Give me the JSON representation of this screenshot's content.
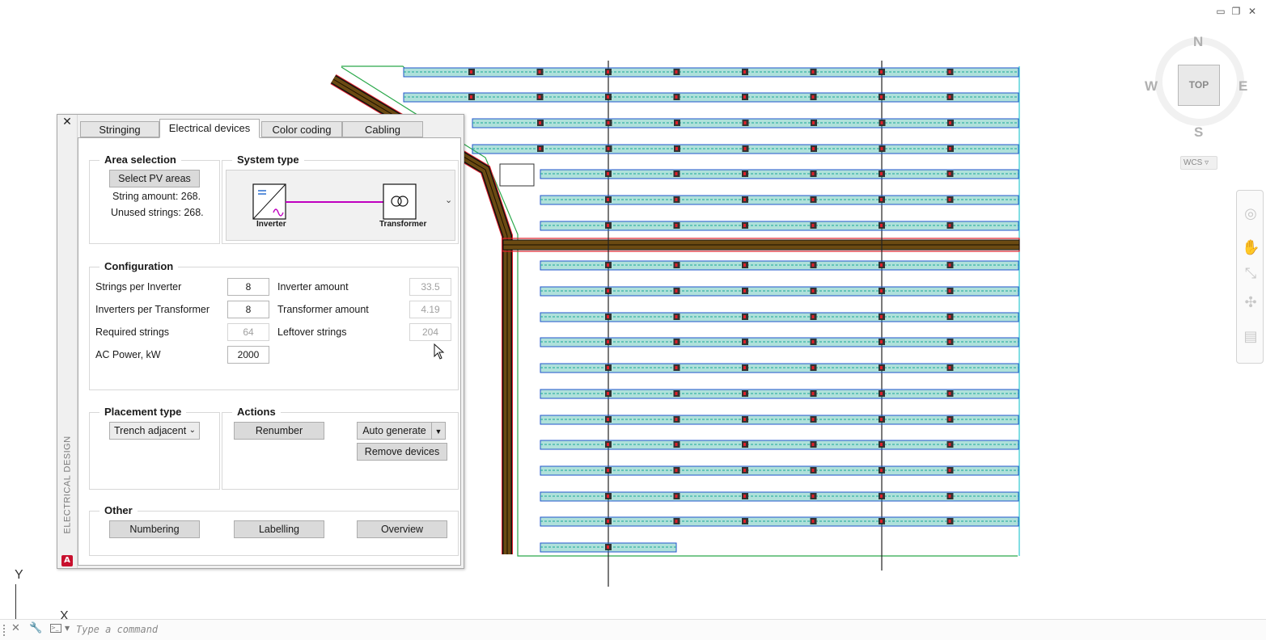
{
  "window_controls": {
    "minimize": "▭",
    "restore": "❐",
    "close": "✕"
  },
  "viewcube": {
    "north": "N",
    "south": "S",
    "east": "E",
    "west": "W",
    "face": "TOP",
    "wcs": "WCS ▿"
  },
  "ucs": {
    "y_label": "Y",
    "x_label": "X"
  },
  "panel": {
    "vertical_title": "ELECTRICAL DESIGN",
    "app_logo": "A",
    "tabs": [
      {
        "label": "Stringing"
      },
      {
        "label": "Electrical devices"
      },
      {
        "label": "Color coding"
      },
      {
        "label": "Cabling"
      }
    ],
    "area_selection": {
      "title": "Area selection",
      "select_button": "Select PV areas",
      "string_amount": "String amount: 268.",
      "unused_strings": "Unused strings: 268."
    },
    "system_type": {
      "title": "System type",
      "inverter_label": "Inverter",
      "transformer_label": "Transformer",
      "dropdown_glyph": "⌄"
    },
    "configuration": {
      "title": "Configuration",
      "rows": [
        {
          "left_label": "Strings per Inverter",
          "left_value": "8",
          "right_label": "Inverter amount",
          "right_value": "33.5"
        },
        {
          "left_label": "Inverters per Transformer",
          "left_value": "8",
          "right_label": "Transformer amount",
          "right_value": "4.19"
        },
        {
          "left_label": "Required strings",
          "left_value": "64",
          "right_label": "Leftover strings",
          "right_value": "204"
        },
        {
          "left_label": "AC Power, kW",
          "left_value": "2000"
        }
      ]
    },
    "placement": {
      "title": "Placement type",
      "selected": "Trench adjacent",
      "caret": "⌄"
    },
    "actions": {
      "title": "Actions",
      "renumber": "Renumber",
      "auto_generate": "Auto generate",
      "remove_devices": "Remove devices"
    },
    "other": {
      "title": "Other",
      "numbering": "Numbering",
      "labelling": "Labelling",
      "overview": "Overview"
    }
  },
  "command_line": {
    "placeholder": "Type a command"
  },
  "colors": {
    "pv_fill": "#1aa896",
    "pv_border": "#2255cc",
    "trench": "#6b4a12",
    "trench_outline": "#e0202a",
    "boundary_green": "#2aa84a",
    "boundary_cyan": "#30c8d0",
    "connector": "#c000c0"
  }
}
